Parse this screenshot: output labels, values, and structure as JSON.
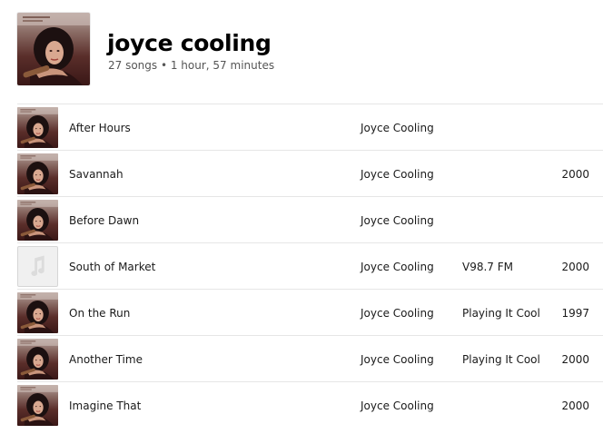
{
  "header": {
    "title": "joyce cooling",
    "meta": "27 songs • 1 hour, 57 minutes",
    "art_icon": "album-cover-icon"
  },
  "colors": {
    "divider": "#e6e6e6",
    "meta_text": "#555555",
    "placeholder_bg": "#f0f0f0"
  },
  "tracks": [
    {
      "title": "After Hours",
      "artist": "Joyce Cooling",
      "album": "",
      "year": "",
      "art": "album-cover"
    },
    {
      "title": "Savannah",
      "artist": "Joyce Cooling",
      "album": "",
      "year": "2000",
      "art": "album-cover"
    },
    {
      "title": "Before Dawn",
      "artist": "Joyce Cooling",
      "album": "",
      "year": "",
      "art": "album-cover"
    },
    {
      "title": "South of Market",
      "artist": "Joyce Cooling",
      "album": "V98.7 FM",
      "year": "2000",
      "art": "music-note-placeholder"
    },
    {
      "title": "On the Run",
      "artist": "Joyce Cooling",
      "album": "Playing It Cool",
      "year": "1997",
      "art": "album-cover"
    },
    {
      "title": "Another Time",
      "artist": "Joyce Cooling",
      "album": "Playing It Cool",
      "year": "2000",
      "art": "album-cover"
    },
    {
      "title": "Imagine That",
      "artist": "Joyce Cooling",
      "album": "",
      "year": "2000",
      "art": "album-cover"
    }
  ]
}
